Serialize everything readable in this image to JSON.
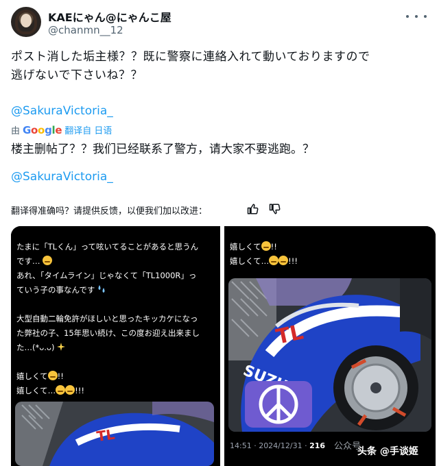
{
  "author": {
    "display_name": "KAEにゃん@にゃんこ屋",
    "handle": "@chanmn__12"
  },
  "post": {
    "text_line1": "ポスト消した垢主様？？既に警察に連絡入れて動いておりますので",
    "text_line2": "逃げないで下さいね？？",
    "mention": "@SakuraVictoria_"
  },
  "translation": {
    "by": "由",
    "google": [
      "G",
      "o",
      "o",
      "g",
      "l",
      "e"
    ],
    "translated_from": "翻译自 日语",
    "text": "楼主删帖了？？我们已经联系了警方，请大家不要逃跑。？",
    "mention": "@SakuraVictoria_",
    "feedback": "翻译得准确吗？请提供反馈，以便我们加以改进："
  },
  "media": {
    "left": {
      "lines": [
        "たまに「TLくん」って呟いてることがあると思うん",
        "です…",
        "あれ、「タイムライン」じゃなくて「TL1000R」っ",
        "ていう子の事なんです",
        "",
        "大型自動二輪免許がほしいと思ったキッカケになっ",
        "た弊社の子、15年思い続け、この度お迎え出来まし",
        "た…(*ᴗ.ᴗ)",
        "",
        "嬉しくて",
        "嬉しくて…"
      ],
      "tail_marks": [
        "!!",
        "!!!"
      ]
    },
    "right": {
      "lines": [
        "嬉しくて",
        "嬉しくて…"
      ],
      "tail_marks": [
        "!!",
        "!!!"
      ],
      "meta_time": "14:51 · 2024/12/31 · ",
      "meta_views": "216",
      "bike_brand": "SUZUKI",
      "bike_logo": "TL"
    },
    "watermark_1": "公众号",
    "watermark_2": "头条 @手谈姬"
  },
  "colors": {
    "link": "#1d9bf0",
    "muted": "#536471",
    "suzuki_blue": "#1f43c6"
  }
}
